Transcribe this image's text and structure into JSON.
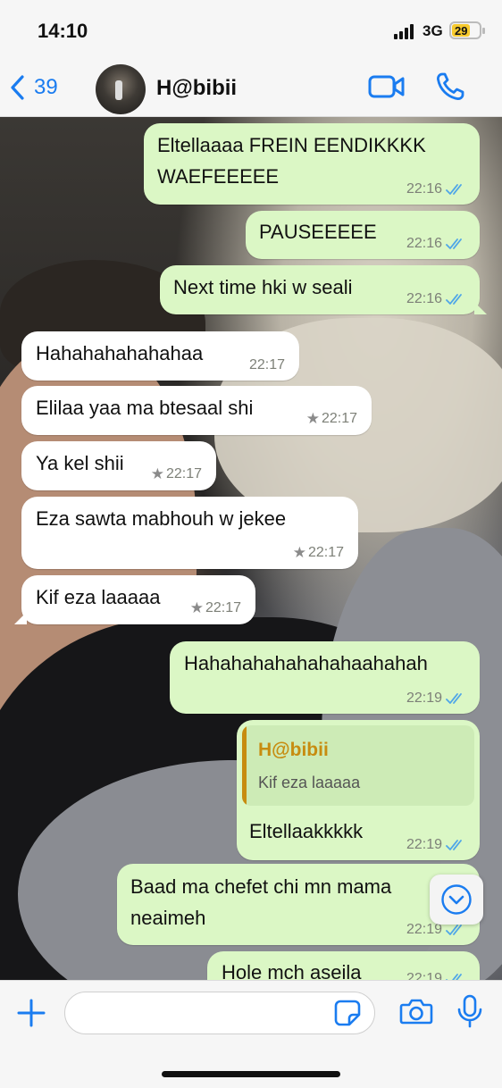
{
  "status": {
    "time": "14:10",
    "network": "3G",
    "battery": "29"
  },
  "nav": {
    "back_count": "39",
    "contact_name": "H@bibii"
  },
  "messages": [
    {
      "dir": "out",
      "lines": [
        "Eltellaaaa FREIN EENDIKKKK",
        "WAEFEEEEE"
      ],
      "time": "22:16",
      "read": true
    },
    {
      "dir": "out",
      "lines": [
        "PAUSEEEEE"
      ],
      "time": "22:16",
      "read": true
    },
    {
      "dir": "out",
      "lines": [
        "Next time hki w seali"
      ],
      "time": "22:16",
      "read": true
    },
    {
      "dir": "in",
      "lines": [
        "Hahahahahahahaa"
      ],
      "time": "22:17",
      "starred": false
    },
    {
      "dir": "in",
      "lines": [
        "Elilaa yaa ma btesaal shi"
      ],
      "time": "22:17",
      "starred": true
    },
    {
      "dir": "in",
      "lines": [
        "Ya kel shii"
      ],
      "time": "22:17",
      "starred": true
    },
    {
      "dir": "in",
      "lines": [
        "Eza sawta mabhouh w jekee"
      ],
      "time": "22:17",
      "starred": true
    },
    {
      "dir": "in",
      "lines": [
        "Kif eza laaaaa"
      ],
      "time": "22:17",
      "starred": true
    },
    {
      "dir": "out",
      "lines": [
        "Hahahahahahahahaahahah"
      ],
      "time": "22:19",
      "read": true
    },
    {
      "dir": "out",
      "quote": {
        "name": "H@bibii",
        "text": "Kif eza laaaaa"
      },
      "lines": [
        "Eltellaakkkkk"
      ],
      "time": "22:19",
      "read": true
    },
    {
      "dir": "out",
      "lines": [
        "Baad ma chefet chi mn mama",
        "neaimeh"
      ],
      "time": "22:19",
      "read": true
    },
    {
      "dir": "out",
      "lines": [
        "Hole mch aseila"
      ],
      "time": "22:19",
      "read": true
    }
  ],
  "icons": {
    "back": "chevron-left-icon",
    "video": "video-camera-icon",
    "call": "phone-icon",
    "scroll": "chevron-down-circle-icon",
    "plus": "plus-icon",
    "sticker": "sticker-icon",
    "camera": "camera-icon",
    "mic": "microphone-icon"
  },
  "colors": {
    "accent": "#1a7cf0",
    "outgoing_bubble": "#dbf7c5",
    "incoming_bubble": "#ffffff",
    "quote_name": "#c78c10",
    "read_ticks": "#4fa6e8"
  }
}
